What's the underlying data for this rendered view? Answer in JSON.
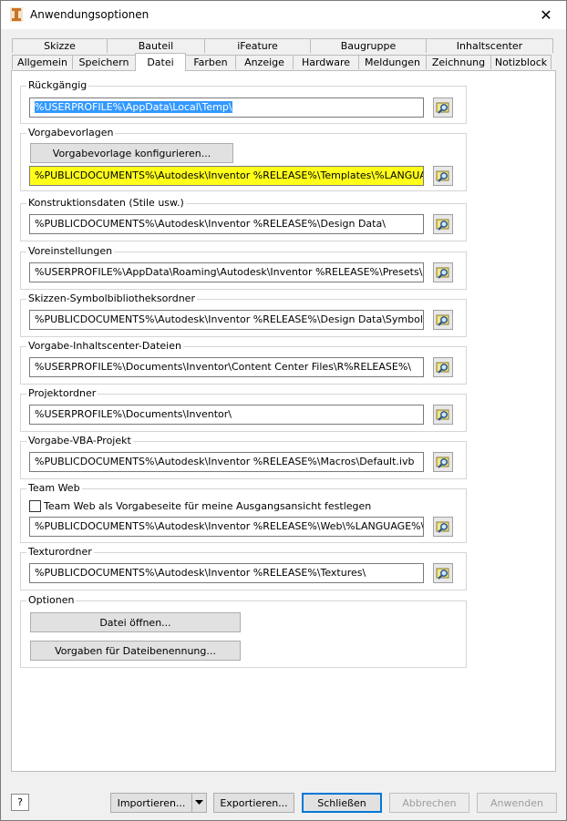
{
  "window": {
    "title": "Anwendungsoptionen",
    "close_glyph": "✕"
  },
  "tabs_row1": [
    "Skizze",
    "Bauteil",
    "iFeature",
    "Baugruppe",
    "Inhaltscenter"
  ],
  "tabs_row2": [
    "Allgemein",
    "Speichern",
    "Datei",
    "Farben",
    "Anzeige",
    "Hardware",
    "Meldungen",
    "Zeichnung",
    "Notizblock"
  ],
  "active_tab": "Datei",
  "groups": {
    "undo": {
      "label": "Rückgängig",
      "path": "%USERPROFILE%\\AppData\\Local\\Temp\\"
    },
    "templates": {
      "label": "Vorgabevorlagen",
      "configure_button": "Vorgabevorlage konfigurieren...",
      "path": "%PUBLICDOCUMENTS%\\Autodesk\\Inventor %RELEASE%\\Templates\\%LANGUAGE%\\"
    },
    "design_data": {
      "label": "Konstruktionsdaten (Stile usw.)",
      "path": "%PUBLICDOCUMENTS%\\Autodesk\\Inventor %RELEASE%\\Design Data\\"
    },
    "presets": {
      "label": "Voreinstellungen",
      "path": "%USERPROFILE%\\AppData\\Roaming\\Autodesk\\Inventor %RELEASE%\\Presets\\"
    },
    "sketch_symbols": {
      "label": "Skizzen-Symbolbibliotheksordner",
      "path": "%PUBLICDOCUMENTS%\\Autodesk\\Inventor %RELEASE%\\Design Data\\Symbol Library\\"
    },
    "content_center": {
      "label": "Vorgabe-Inhaltscenter-Dateien",
      "path": "%USERPROFILE%\\Documents\\Inventor\\Content Center Files\\R%RELEASE%\\"
    },
    "project": {
      "label": "Projektordner",
      "path": "%USERPROFILE%\\Documents\\Inventor\\"
    },
    "vba": {
      "label": "Vorgabe-VBA-Projekt",
      "path": "%PUBLICDOCUMENTS%\\Autodesk\\Inventor %RELEASE%\\Macros\\Default.ivb"
    },
    "team_web": {
      "label": "Team Web",
      "checkbox_label": "Team Web als Vorgabeseite für meine Ausgangsansicht festlegen",
      "checked": false,
      "path": "%PUBLICDOCUMENTS%\\Autodesk\\Inventor %RELEASE%\\Web\\%LANGUAGE%\\Custom"
    },
    "textures": {
      "label": "Texturordner",
      "path": "%PUBLICDOCUMENTS%\\Autodesk\\Inventor %RELEASE%\\Textures\\"
    },
    "options": {
      "label": "Optionen",
      "open_file_button": "Datei öffnen...",
      "naming_button": "Vorgaben für Dateibenennung..."
    }
  },
  "footer": {
    "help": "?",
    "import": "Importieren...",
    "export": "Exportieren...",
    "close": "Schließen",
    "cancel": "Abbrechen",
    "apply": "Anwenden"
  },
  "colors": {
    "highlight": "#ffff1a",
    "selection": "#3399ff",
    "default_button_border": "#0078d7"
  }
}
